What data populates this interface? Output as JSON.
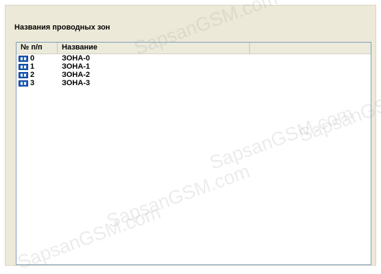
{
  "group": {
    "title": "Названия проводных зон"
  },
  "table": {
    "columns": [
      "№ п/п",
      "Название",
      ""
    ],
    "rows": [
      {
        "num": "0",
        "name": "ЗОНА-0",
        "icon": "zone-icon"
      },
      {
        "num": "1",
        "name": "ЗОНА-1",
        "icon": "zone-icon"
      },
      {
        "num": "2",
        "name": "ЗОНА-2",
        "icon": "zone-icon"
      },
      {
        "num": "3",
        "name": "ЗОНА-3",
        "icon": "zone-icon"
      }
    ]
  },
  "watermark": {
    "text": "SapsanGSM.com"
  },
  "colors": {
    "panel": "#ece9d8",
    "list_border": "#7f9db9",
    "icon_blue": "#1f5fbf"
  }
}
